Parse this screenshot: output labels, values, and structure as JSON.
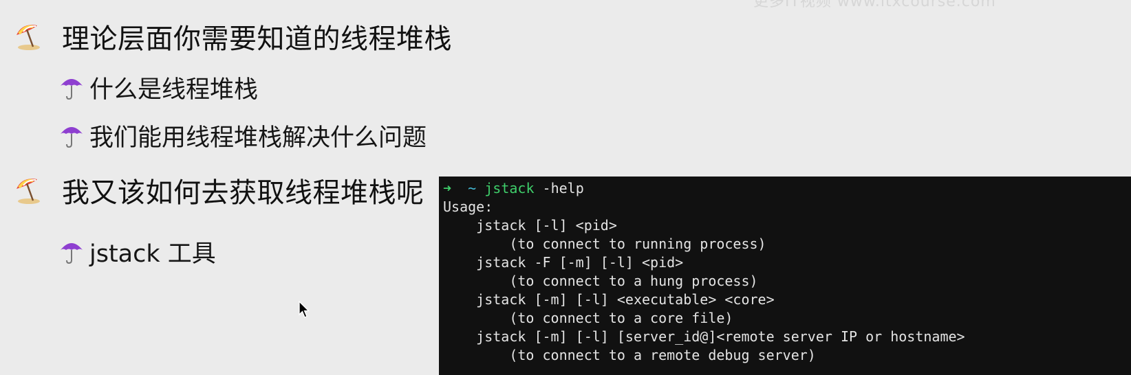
{
  "watermark": "更多IT视频 www.itxcourse.com",
  "headings": [
    {
      "icon": "beach-umbrella-icon",
      "text": "理论层面你需要知道的线程堆栈"
    },
    {
      "icon": "beach-umbrella-icon",
      "text": "我又该如何去获取线程堆栈呢"
    }
  ],
  "subitems": [
    {
      "icon": "umbrella-icon",
      "text": "什么是线程堆栈"
    },
    {
      "icon": "umbrella-icon",
      "text": "我们能用线程堆栈解决什么问题"
    },
    {
      "icon": "umbrella-icon",
      "text": "jstack 工具"
    }
  ],
  "terminal": {
    "prompt_arrow": "➜",
    "prompt_dir": "~",
    "command": "jstack",
    "command_args": " -help",
    "output": [
      "Usage:",
      "    jstack [-l] <pid>",
      "        (to connect to running process)",
      "    jstack -F [-m] [-l] <pid>",
      "        (to connect to a hung process)",
      "    jstack [-m] [-l] <executable> <core>",
      "        (to connect to a core file)",
      "    jstack [-m] [-l] [server_id@]<remote server IP or hostname>",
      "        (to connect to a remote debug server)"
    ]
  },
  "colors": {
    "background": "#ebebeb",
    "terminal_bg": "#111111",
    "prompt_green": "#3fcf6b",
    "prompt_cyan": "#44b9d4",
    "umbrella_purple": "#8e3fd0"
  }
}
